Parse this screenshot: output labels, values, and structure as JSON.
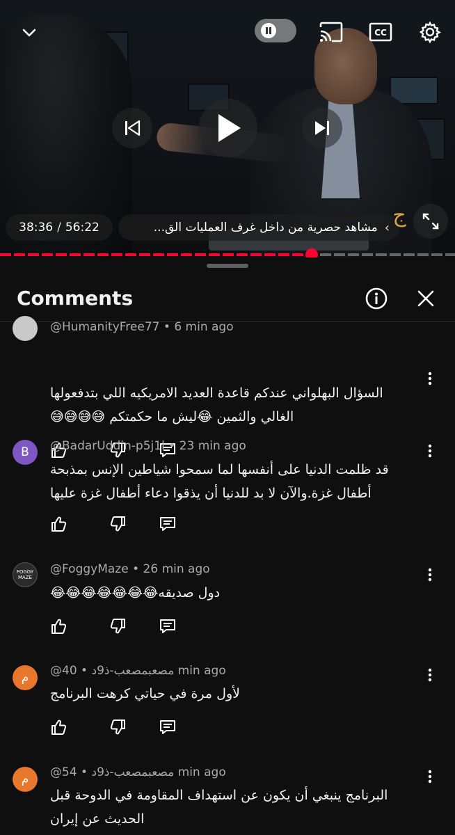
{
  "player": {
    "current_time": "38:36",
    "separator": "/",
    "duration": "56:22",
    "chapter_title": "مشاهد حصرية من داخل غرف العمليات الق...",
    "chapter_chevron": "‹",
    "progress_fraction": 0.685,
    "autoplay_on": false,
    "accent_color": "#ff0033"
  },
  "panel": {
    "title": "Comments"
  },
  "comments": [
    {
      "handle": "@HumanityFree77",
      "age": "6 min ago",
      "avatar_letter": "",
      "avatar_color": "#c9c9c9",
      "text": "السؤال البهلواني عندكم قاعدة العديد الامريكيه اللي بتدفعولها الغالي والثمين 😂ليش ما حكمتكم 😅😅😅😅"
    },
    {
      "handle": "@BadarUddin-p5j1l",
      "age": "23 min ago",
      "avatar_letter": "B",
      "avatar_color": "#7e57c2",
      "text": "قد ظلمت الدنيا على أنفسها لما سمحوا شياطين الإنس بمذبحة أطفال غزة.والآن لا بد للدنيا أن يذقوا دعاء أطفال غزة عليها"
    },
    {
      "handle": "@FoggyMaze",
      "age": "26 min ago",
      "avatar_letter": "FOGGY MAZE",
      "avatar_color": "#2b2b2b",
      "text": "دول صديقه😂😂😂😂😂😂😂"
    },
    {
      "handle": "@مصعبمصعب-ذ9د",
      "age": "40 min ago",
      "avatar_letter": "م",
      "avatar_color": "#e8762c",
      "text": "لأول مرة في حياتي  كرهت البرنامج"
    },
    {
      "handle": "@مصعبمصعب-ذ9د",
      "age": "54 min ago",
      "avatar_letter": "م",
      "avatar_color": "#e8762c",
      "text": "البرنامج ينبغي أن يكون عن استهداف المقاومة في الدوحة قبل الحديث عن إيران"
    }
  ],
  "icons": {
    "collapse": "chevron-down-icon",
    "autoplay": "autoplay-toggle",
    "cast": "cast-icon",
    "captions": "cc-icon",
    "settings": "gear-icon",
    "previous": "previous-icon",
    "play": "play-icon",
    "next": "next-icon",
    "fullscreen": "fullscreen-icon",
    "info": "info-icon",
    "close": "close-icon",
    "like": "thumbs-up-icon",
    "dislike": "thumbs-down-icon",
    "reply": "reply-icon",
    "more": "more-vert-icon"
  }
}
